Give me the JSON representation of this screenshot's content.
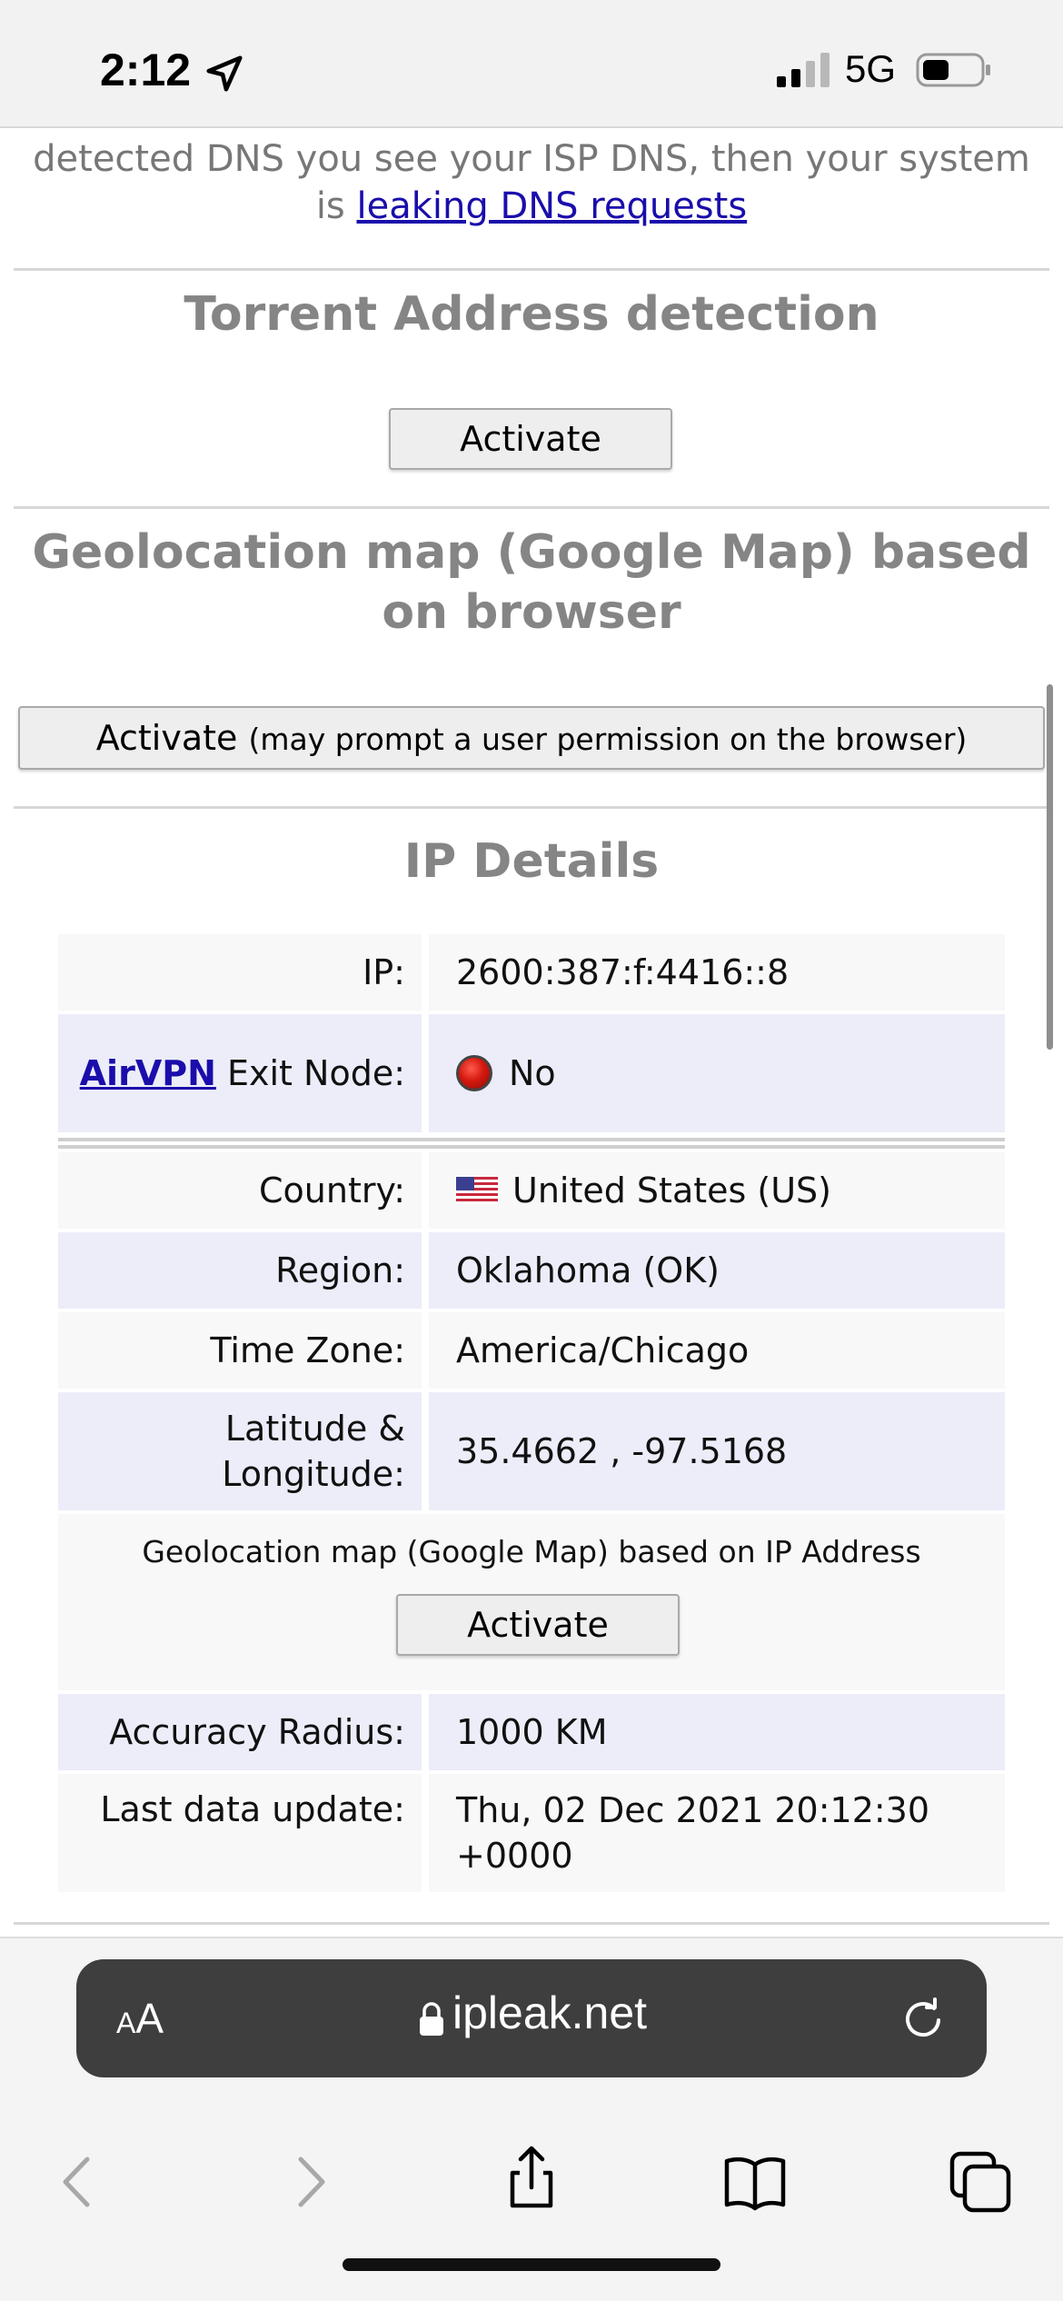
{
  "status_bar": {
    "time": "2:12",
    "network": "5G"
  },
  "page": {
    "intro_text": "detected DNS you see your ISP DNS, then your system is",
    "intro_link": "leaking DNS requests",
    "torrent": {
      "title": "Torrent Address detection",
      "button": "Activate"
    },
    "geo_browser": {
      "title": "Geolocation map (Google Map) based on browser",
      "button": "Activate",
      "button_note": "(may prompt a user permission on the browser)"
    },
    "ip_details": {
      "title": "IP Details",
      "ip_label": "IP:",
      "ip_value": "2600:387:f:4416::8",
      "exit_link": "AirVPN",
      "exit_label": "Exit Node:",
      "exit_value": "No",
      "country_label": "Country:",
      "country_value": "United States (US)",
      "region_label": "Region:",
      "region_value": "Oklahoma (OK)",
      "tz_label": "Time Zone:",
      "tz_value": "America/Chicago",
      "latlon_label": "Latitude & Longitude:",
      "latlon_value": "35.4662 , -97.5168",
      "map_caption": "Geolocation map (Google Map) based on IP Address",
      "map_button": "Activate",
      "accuracy_label": "Accuracy Radius:",
      "accuracy_value": "1000 KM",
      "update_label": "Last data update:",
      "update_value": "Thu, 02 Dec 2021 20:12:30 +0000"
    }
  },
  "browser": {
    "text_size_small": "A",
    "text_size_large": "A",
    "domain": "ipleak.net"
  },
  "icons": {
    "location": "location-arrow-icon",
    "signal": "cellular-signal-icon",
    "battery": "battery-icon",
    "no_status": "red-dot-icon",
    "flag": "us-flag-icon",
    "lock": "lock-icon",
    "reload": "reload-icon",
    "back": "chevron-left-icon",
    "forward": "chevron-right-icon",
    "share": "share-icon",
    "bookmarks": "book-icon",
    "tabs": "tabs-icon"
  }
}
